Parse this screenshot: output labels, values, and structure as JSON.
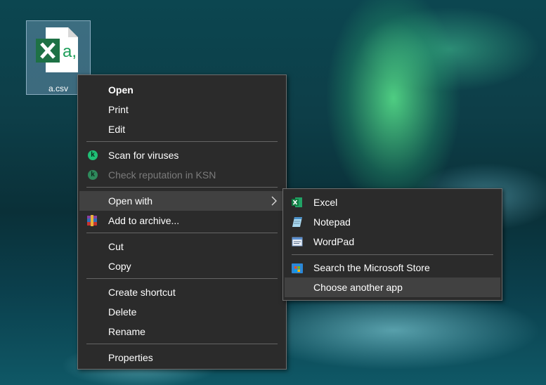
{
  "desktop": {
    "file": {
      "label": "a.csv",
      "icon": "excel-csv-file-icon"
    }
  },
  "context_menu": {
    "items": [
      {
        "label": "Open"
      },
      {
        "label": "Print"
      },
      {
        "label": "Edit"
      },
      {
        "label": "Scan for viruses",
        "icon": "kaspersky-icon"
      },
      {
        "label": "Check reputation in KSN",
        "icon": "kaspersky-icon"
      },
      {
        "label": "Open with",
        "icon": "chevron-right-icon"
      },
      {
        "label": "Add to archive...",
        "icon": "winrar-icon"
      },
      {
        "label": "Cut"
      },
      {
        "label": "Copy"
      },
      {
        "label": "Create shortcut"
      },
      {
        "label": "Delete"
      },
      {
        "label": "Rename"
      },
      {
        "label": "Properties"
      }
    ]
  },
  "open_with_menu": {
    "items": [
      {
        "label": "Excel",
        "icon": "excel-icon"
      },
      {
        "label": "Notepad",
        "icon": "notepad-icon"
      },
      {
        "label": "WordPad",
        "icon": "wordpad-icon"
      },
      {
        "label": "Search the Microsoft Store",
        "icon": "microsoft-store-icon"
      },
      {
        "label": "Choose another app"
      }
    ]
  },
  "colors": {
    "menu_background": "#2b2b2b",
    "menu_hover": "#414141",
    "excel_green": "#1e7145",
    "kaspersky_green": "#1fbf75"
  }
}
